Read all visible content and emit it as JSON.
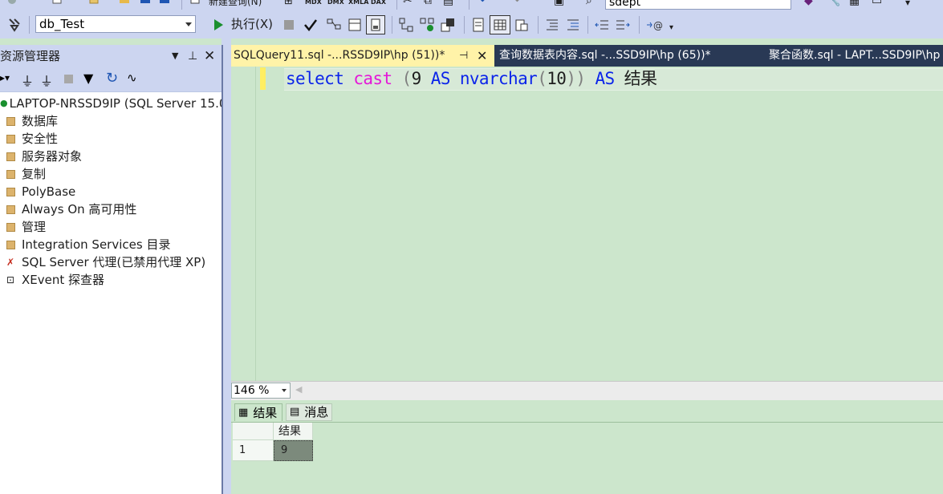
{
  "toolbar_top": {
    "new_query_label": "新建查询(N)",
    "mdx": "MDX",
    "dmx": "DMX",
    "xmla": "XMLA",
    "dax": "DAX",
    "search_value": "sdept"
  },
  "toolbar_main": {
    "database": "db_Test",
    "execute_label": "执行(X)"
  },
  "object_explorer": {
    "title": "资源管理器",
    "server": "LAPTOP-NRSSD9IP (SQL Server 15.0.",
    "items": [
      {
        "label": "数据库",
        "icon": "folder-icon"
      },
      {
        "label": "安全性",
        "icon": "folder-icon"
      },
      {
        "label": "服务器对象",
        "icon": "folder-icon"
      },
      {
        "label": "复制",
        "icon": "folder-icon"
      },
      {
        "label": "PolyBase",
        "icon": "folder-icon"
      },
      {
        "label": "Always On 高可用性",
        "icon": "folder-icon"
      },
      {
        "label": "管理",
        "icon": "folder-icon"
      },
      {
        "label": "Integration Services 目录",
        "icon": "folder-icon"
      },
      {
        "label": "SQL Server 代理(已禁用代理 XP)",
        "icon": "agent-icon"
      },
      {
        "label": "XEvent 探查器",
        "icon": "xevent-icon"
      }
    ]
  },
  "tabs": [
    {
      "label": "SQLQuery11.sql -...RSSD9IP\\hp (51))*"
    },
    {
      "label": "查询数据表内容.sql -...SSD9IP\\hp (65))*"
    },
    {
      "label": "聚合函数.sql - LAPT...SSD9IP\\hp"
    }
  ],
  "editor": {
    "tokens": [
      "select",
      "cast",
      "(",
      "9",
      "AS",
      "nvarchar",
      "(",
      "10",
      "))",
      "AS",
      "结果"
    ]
  },
  "zoom": "146 %",
  "results": {
    "tabs": [
      "结果",
      "消息"
    ],
    "columns": [
      "结果"
    ],
    "rows": [
      {
        "num": "1",
        "value": "9"
      }
    ]
  },
  "colors": {
    "keyword": "#0b24ea",
    "function": "#e418d8",
    "active_tab": "#fff3a8",
    "editor_bg": "#cce6cc",
    "tabstrip": "#293955"
  }
}
